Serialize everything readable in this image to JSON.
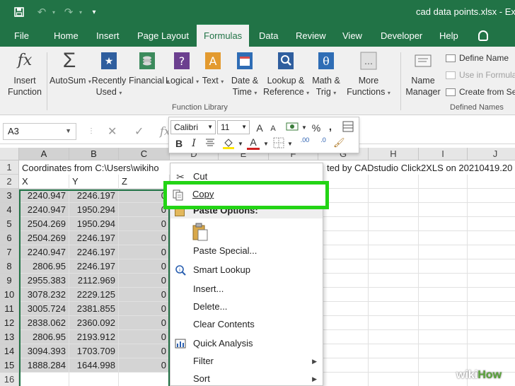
{
  "window": {
    "document_title": "cad data points.xlsx  -  Ex"
  },
  "colors": {
    "brand": "#217346",
    "highlight": "#23d415",
    "selection": "#d4d4d4"
  },
  "quick_access": {
    "icons": [
      "save-icon",
      "undo-icon",
      "redo-icon",
      "customize-icon"
    ]
  },
  "tabs": [
    "File",
    "Home",
    "Insert",
    "Page Layout",
    "Formulas",
    "Data",
    "Review",
    "View",
    "Developer",
    "Help"
  ],
  "active_tab": "Formulas",
  "ribbon": {
    "insert_function": [
      "Insert",
      "Function"
    ],
    "autosum": [
      "AutoSum"
    ],
    "recently_used": [
      "Recently",
      "Used"
    ],
    "financial": [
      "Financial"
    ],
    "logical": [
      "Logical"
    ],
    "text": [
      "Text"
    ],
    "date_time": [
      "Date &",
      "Time"
    ],
    "lookup_reference": [
      "Lookup &",
      "Reference"
    ],
    "math_trig": [
      "Math &",
      "Trig"
    ],
    "more_functions": [
      "More",
      "Functions"
    ],
    "function_library_label": "Function Library",
    "name_manager": [
      "Name",
      "Manager"
    ],
    "define_name": "Define Name",
    "use_in_formula": "Use in Formula",
    "create_from_selection": "Create from Se",
    "defined_names_label": "Defined Names"
  },
  "formula_bar": {
    "name_box": "A3",
    "fx": "fx"
  },
  "mini_toolbar": {
    "font_name": "Calibri",
    "font_size": "11",
    "grow_font": "A",
    "shrink_font": "A",
    "percent": "%",
    "comma": ",",
    "bold": "B",
    "italic": "I",
    "font_color": "A",
    "increase_decimal": ".00",
    "decrease_decimal": ".0"
  },
  "columns": [
    "A",
    "B",
    "C",
    "D",
    "E",
    "F",
    "G",
    "H",
    "I",
    "J"
  ],
  "rows": [
    "1",
    "2",
    "3",
    "4",
    "5",
    "6",
    "7",
    "8",
    "9",
    "10",
    "11",
    "12",
    "13",
    "14",
    "15",
    "16"
  ],
  "sheet": {
    "row1": "Coordinates from C:\\Users\\wikiho",
    "row1_right": "ted by CADstudio Click2XLS on 20210419.20",
    "headers": [
      "X",
      "Y",
      "Z"
    ],
    "data": [
      [
        "2240.947",
        "2246.197",
        "0"
      ],
      [
        "2240.947",
        "1950.294",
        "0"
      ],
      [
        "2504.269",
        "1950.294",
        "0"
      ],
      [
        "2504.269",
        "2246.197",
        "0"
      ],
      [
        "2240.947",
        "2246.197",
        "0"
      ],
      [
        "2806.95",
        "2246.197",
        "0"
      ],
      [
        "2955.383",
        "2112.969",
        "0"
      ],
      [
        "3078.232",
        "2229.125",
        "0"
      ],
      [
        "3005.724",
        "2381.855",
        "0"
      ],
      [
        "2838.062",
        "2360.092",
        "0"
      ],
      [
        "2806.95",
        "2193.912",
        "0"
      ],
      [
        "3094.393",
        "1703.709",
        "0"
      ],
      [
        "1888.284",
        "1644.998",
        "0"
      ]
    ]
  },
  "context_menu": {
    "cut": "Cut",
    "copy": "Copy",
    "paste_options": "Paste Options:",
    "paste_special": "Paste Special...",
    "smart_lookup": "Smart Lookup",
    "insert": "Insert...",
    "delete": "Delete...",
    "clear_contents": "Clear Contents",
    "quick_analysis": "Quick Analysis",
    "filter": "Filter",
    "sort": "Sort"
  },
  "watermark": {
    "wiki": "wiki",
    "how": "How"
  }
}
